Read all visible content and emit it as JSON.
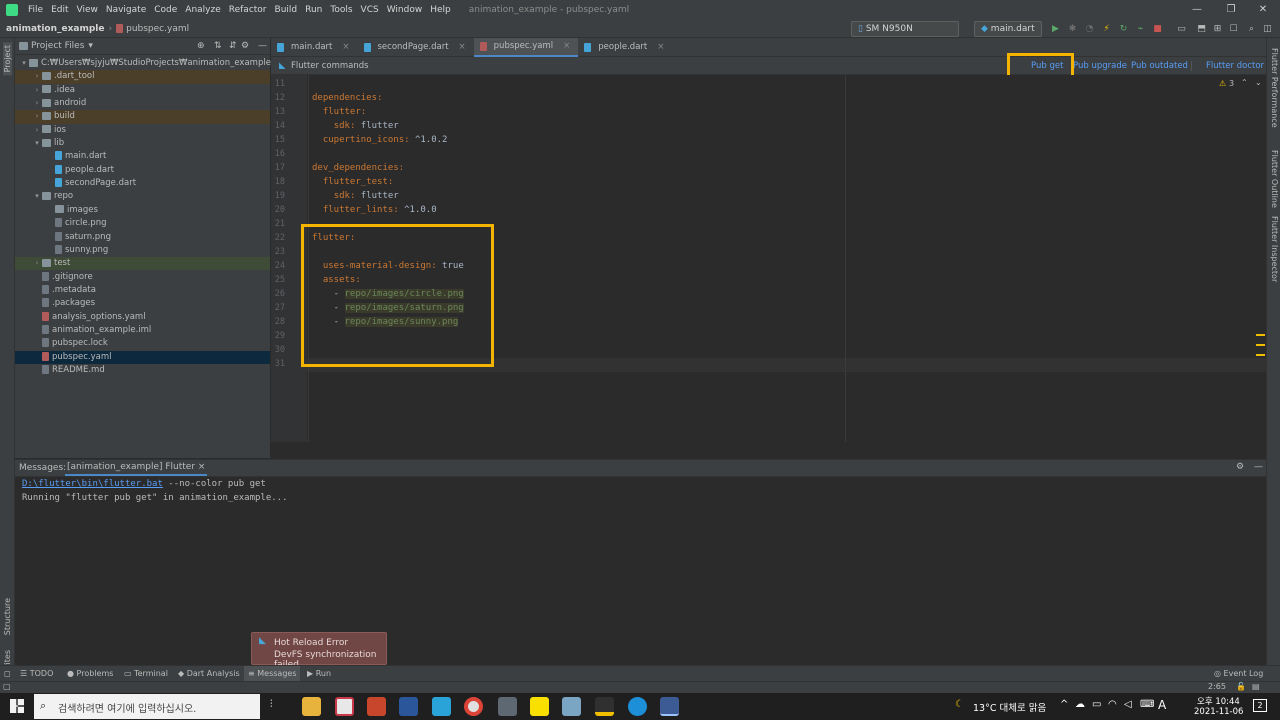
{
  "window": {
    "menus": [
      "File",
      "Edit",
      "View",
      "Navigate",
      "Code",
      "Analyze",
      "Refactor",
      "Build",
      "Run",
      "Tools",
      "VCS",
      "Window",
      "Help"
    ],
    "title": "animation_example - pubspec.yaml",
    "controls": {
      "minimize": "—",
      "maximize": "❐",
      "close": "✕"
    }
  },
  "navbar": {
    "project": "animation_example",
    "file": "pubspec.yaml",
    "device": "SM N950N (mobile)",
    "run_config": "main.dart"
  },
  "left_stripe": {
    "project": "Project",
    "structure": "Structure",
    "favorites": "Favorites"
  },
  "right_stripe": {
    "performance": "Flutter Performance",
    "outline": "Flutter Outline",
    "inspector": "Flutter Inspector"
  },
  "project_panel": {
    "header": "Project Files",
    "root": "C:₩Users₩sjyju₩StudioProjects₩animation_example",
    "items": [
      {
        "label": ".dart_tool",
        "kind": "folder",
        "state": "collapsed",
        "style": "excluded"
      },
      {
        "label": ".idea",
        "kind": "folder",
        "state": "collapsed",
        "style": ""
      },
      {
        "label": "android",
        "kind": "folder",
        "state": "collapsed",
        "style": ""
      },
      {
        "label": "build",
        "kind": "folder",
        "state": "collapsed",
        "style": "excluded"
      },
      {
        "label": "ios",
        "kind": "folder",
        "state": "collapsed",
        "style": ""
      },
      {
        "label": "lib",
        "kind": "folder",
        "state": "expanded",
        "style": ""
      },
      {
        "label": "main.dart",
        "kind": "dart",
        "state": "",
        "style": ""
      },
      {
        "label": "people.dart",
        "kind": "dart",
        "state": "",
        "style": ""
      },
      {
        "label": "secondPage.dart",
        "kind": "dart",
        "state": "",
        "style": ""
      },
      {
        "label": "repo",
        "kind": "folder",
        "state": "expanded",
        "style": ""
      },
      {
        "label": "images",
        "kind": "folder",
        "state": "",
        "style": ""
      },
      {
        "label": "circle.png",
        "kind": "file",
        "state": "",
        "style": ""
      },
      {
        "label": "saturn.png",
        "kind": "file",
        "state": "",
        "style": ""
      },
      {
        "label": "sunny.png",
        "kind": "file",
        "state": "",
        "style": ""
      },
      {
        "label": "test",
        "kind": "folder",
        "state": "collapsed",
        "style": "test"
      },
      {
        "label": ".gitignore",
        "kind": "file",
        "state": "",
        "style": ""
      },
      {
        "label": ".metadata",
        "kind": "file",
        "state": "",
        "style": ""
      },
      {
        "label": ".packages",
        "kind": "file",
        "state": "",
        "style": ""
      },
      {
        "label": "analysis_options.yaml",
        "kind": "yaml",
        "state": "",
        "style": ""
      },
      {
        "label": "animation_example.iml",
        "kind": "file",
        "state": "",
        "style": ""
      },
      {
        "label": "pubspec.lock",
        "kind": "file",
        "state": "",
        "style": ""
      },
      {
        "label": "pubspec.yaml",
        "kind": "yaml",
        "state": "",
        "style": "selected"
      },
      {
        "label": "README.md",
        "kind": "file",
        "state": "",
        "style": ""
      }
    ]
  },
  "tabs": [
    {
      "label": "main.dart",
      "active": false
    },
    {
      "label": "secondPage.dart",
      "active": false
    },
    {
      "label": "pubspec.yaml",
      "active": true
    },
    {
      "label": "people.dart",
      "active": false
    }
  ],
  "flutter_commands": {
    "label": "Flutter commands",
    "pub_get": "Pub get",
    "pub_upgrade": "Pub upgrade",
    "pub_outdated": "Pub outdated",
    "doctor": "Flutter doctor",
    "warnings": "3"
  },
  "editor": {
    "lines": [
      {
        "n": "11",
        "text": ""
      },
      {
        "n": "12",
        "text": "dependencies:"
      },
      {
        "n": "13",
        "text": "  flutter:"
      },
      {
        "n": "14",
        "text": "    sdk: flutter"
      },
      {
        "n": "15",
        "text": "  cupertino_icons: ^1.0.2"
      },
      {
        "n": "16",
        "text": ""
      },
      {
        "n": "17",
        "text": "dev_dependencies:"
      },
      {
        "n": "18",
        "text": "  flutter_test:"
      },
      {
        "n": "19",
        "text": "    sdk: flutter"
      },
      {
        "n": "20",
        "text": "  flutter_lints: ^1.0.0"
      },
      {
        "n": "21",
        "text": ""
      },
      {
        "n": "22",
        "text": "flutter:"
      },
      {
        "n": "23",
        "text": ""
      },
      {
        "n": "24",
        "text": "  uses-material-design: true"
      },
      {
        "n": "25",
        "text": "  assets:"
      },
      {
        "n": "26",
        "text": "    - repo/images/circle.png"
      },
      {
        "n": "27",
        "text": "    - repo/images/saturn.png"
      },
      {
        "n": "28",
        "text": "    - repo/images/sunny.png"
      },
      {
        "n": "29",
        "text": ""
      },
      {
        "n": "30",
        "text": ""
      },
      {
        "n": "31",
        "text": ""
      }
    ]
  },
  "messages": {
    "title": "Messages:",
    "tab": "[animation_example] Flutter",
    "line1_link": "D:\\flutter\\bin\\flutter.bat",
    "line1_rest": " --no-color pub get",
    "line2": "Running \"flutter pub get\" in animation_example..."
  },
  "toast": {
    "title": "Hot Reload Error",
    "body": "DevFS synchronization failed"
  },
  "tool_windows": [
    "TODO",
    "Problems",
    "Terminal",
    "Dart Analysis",
    "Messages",
    "Run"
  ],
  "event_log": "Event Log",
  "status": {
    "position": "2:65"
  },
  "taskbar": {
    "search_placeholder": "검색하려면 여기에 입력하십시오.",
    "weather": "13°C 대체로 맑음",
    "ime": "A",
    "time": "오후 10:44",
    "date": "2021-11-06",
    "notifications": "2"
  },
  "colors": {
    "accent": "#4a88c7",
    "callout": "#f5b400",
    "link": "#589df6"
  }
}
